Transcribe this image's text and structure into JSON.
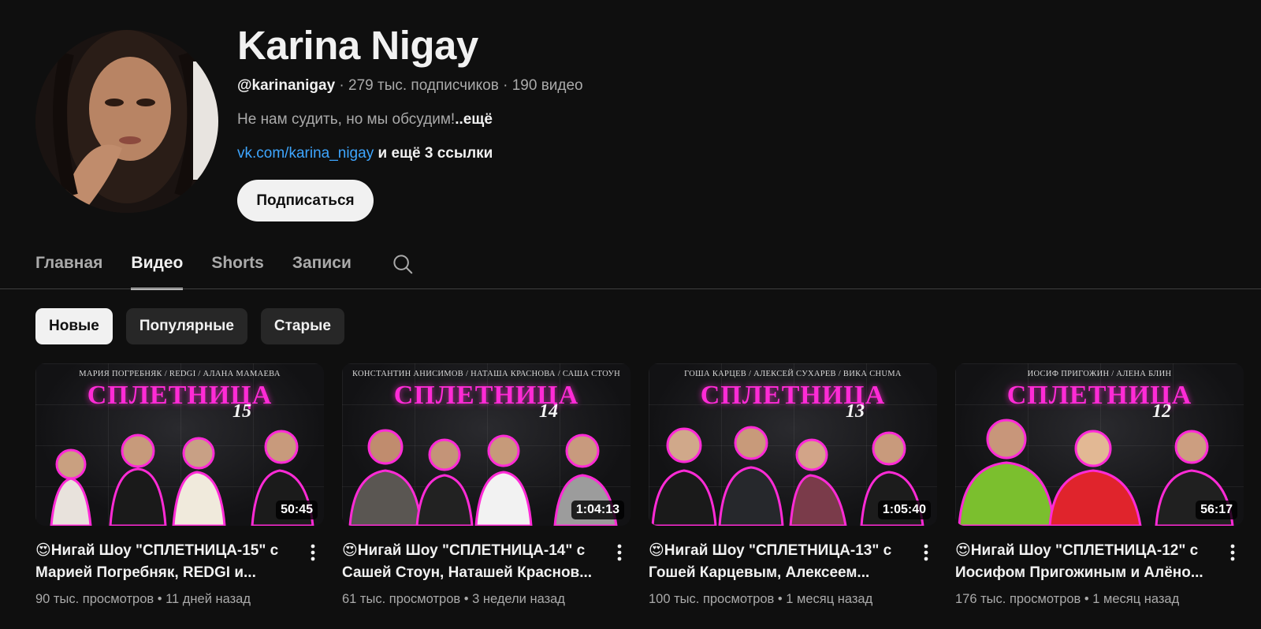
{
  "channel": {
    "name": "Karina Nigay",
    "handle": "@karinanigay",
    "subscribers": " · 279 тыс. подписчиков · 190 видео",
    "description": "Не нам судить, но мы обсудим!",
    "description_more": "..ещё",
    "link": "vk.com/karina_nigay",
    "more_links": " и ещё 3 ссылки",
    "subscribe_label": "Подписаться"
  },
  "tabs": [
    {
      "label": "Главная",
      "active": false
    },
    {
      "label": "Видео",
      "active": true
    },
    {
      "label": "Shorts",
      "active": false
    },
    {
      "label": "Записи",
      "active": false
    }
  ],
  "chips": [
    {
      "label": "Новые",
      "selected": true
    },
    {
      "label": "Популярные",
      "selected": false
    },
    {
      "label": "Старые",
      "selected": false
    }
  ],
  "videos": [
    {
      "thumb_names": "МАРИЯ ПОГРЕБНЯК  /  REDGI  /  АЛАНА МАМАЕВА",
      "thumb_title": "СПЛЕТНИЦА",
      "thumb_num": "15",
      "duration": "50:45",
      "title": "😍Нигай Шоу \"СПЛЕТНИЦА-15\" с Марией Погребняк, REDGI и...",
      "stats": "90 тыс. просмотров • 11 дней назад"
    },
    {
      "thumb_names": "КОНСТАНТИН АНИСИМОВ  /  НАТАША КРАСНОВА  /  САША СТОУН",
      "thumb_title": "СПЛЕТНИЦА",
      "thumb_num": "14",
      "duration": "1:04:13",
      "title": "😍Нигай Шоу \"СПЛЕТНИЦА-14\" с Сашей Стоун, Наташей Краснов...",
      "stats": "61 тыс. просмотров • 3 недели назад"
    },
    {
      "thumb_names": "ГОША КАРЦЕВ  /  АЛЕКСЕЙ СУХАРЕВ  /  ВИКА CHUMA",
      "thumb_title": "СПЛЕТНИЦА",
      "thumb_num": "13",
      "duration": "1:05:40",
      "title": "😍Нигай Шоу \"СПЛЕТНИЦА-13\" с Гошей Карцевым, Алексеем...",
      "stats": "100 тыс. просмотров • 1 месяц назад"
    },
    {
      "thumb_names": "ИОСИФ ПРИГОЖИН  /  АЛЕНА БЛИН",
      "thumb_title": "СПЛЕТНИЦА",
      "thumb_num": "12",
      "duration": "56:17",
      "title": "😍Нигай Шоу \"СПЛЕТНИЦА-12\" с Иосифом Пригожиным и Алёно...",
      "stats": "176 тыс. просмотров • 1 месяц назад"
    }
  ],
  "icons": {
    "search": "search-icon",
    "more": "more-vert-icon"
  },
  "colors": {
    "background": "#0f0f0f",
    "link": "#3ea6ff",
    "thumb_accent": "#ff2bd6"
  }
}
